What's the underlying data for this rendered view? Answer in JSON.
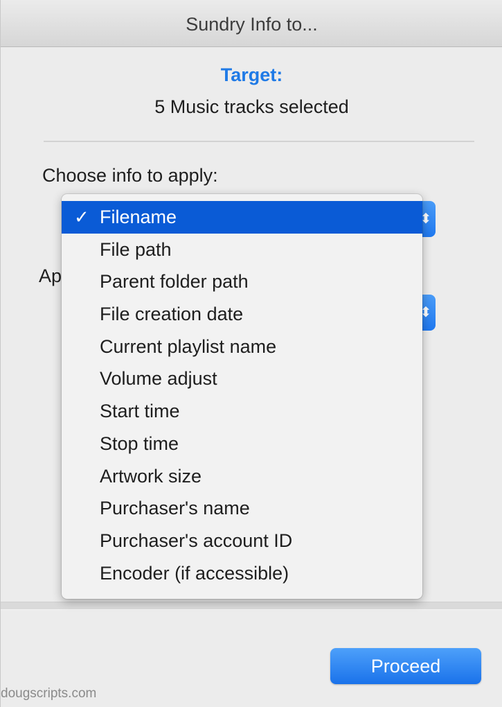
{
  "window": {
    "title": "Sundry Info to..."
  },
  "target": {
    "label": "Target:",
    "value": "5 Music tracks selected"
  },
  "choose": {
    "label": "Choose info to apply:",
    "stepper_glyph": "⬍"
  },
  "apply": {
    "label_fragment": "Ap",
    "stepper_glyph": "⬍"
  },
  "menu": {
    "check_glyph": "✓",
    "selected_index": 0,
    "items": [
      "Filename",
      "File path",
      "Parent folder path",
      "File creation date",
      "Current playlist name",
      "Volume adjust",
      "Start time",
      "Stop time",
      "Artwork size",
      "Purchaser's name",
      "Purchaser's account ID",
      "Encoder (if accessible)"
    ]
  },
  "buttons": {
    "proceed": "Proceed"
  },
  "footer": {
    "credit": "dougscripts.com"
  },
  "colors": {
    "accent": "#1f7ae6",
    "selection": "#0a5bd6",
    "button": "#1a72ea"
  }
}
